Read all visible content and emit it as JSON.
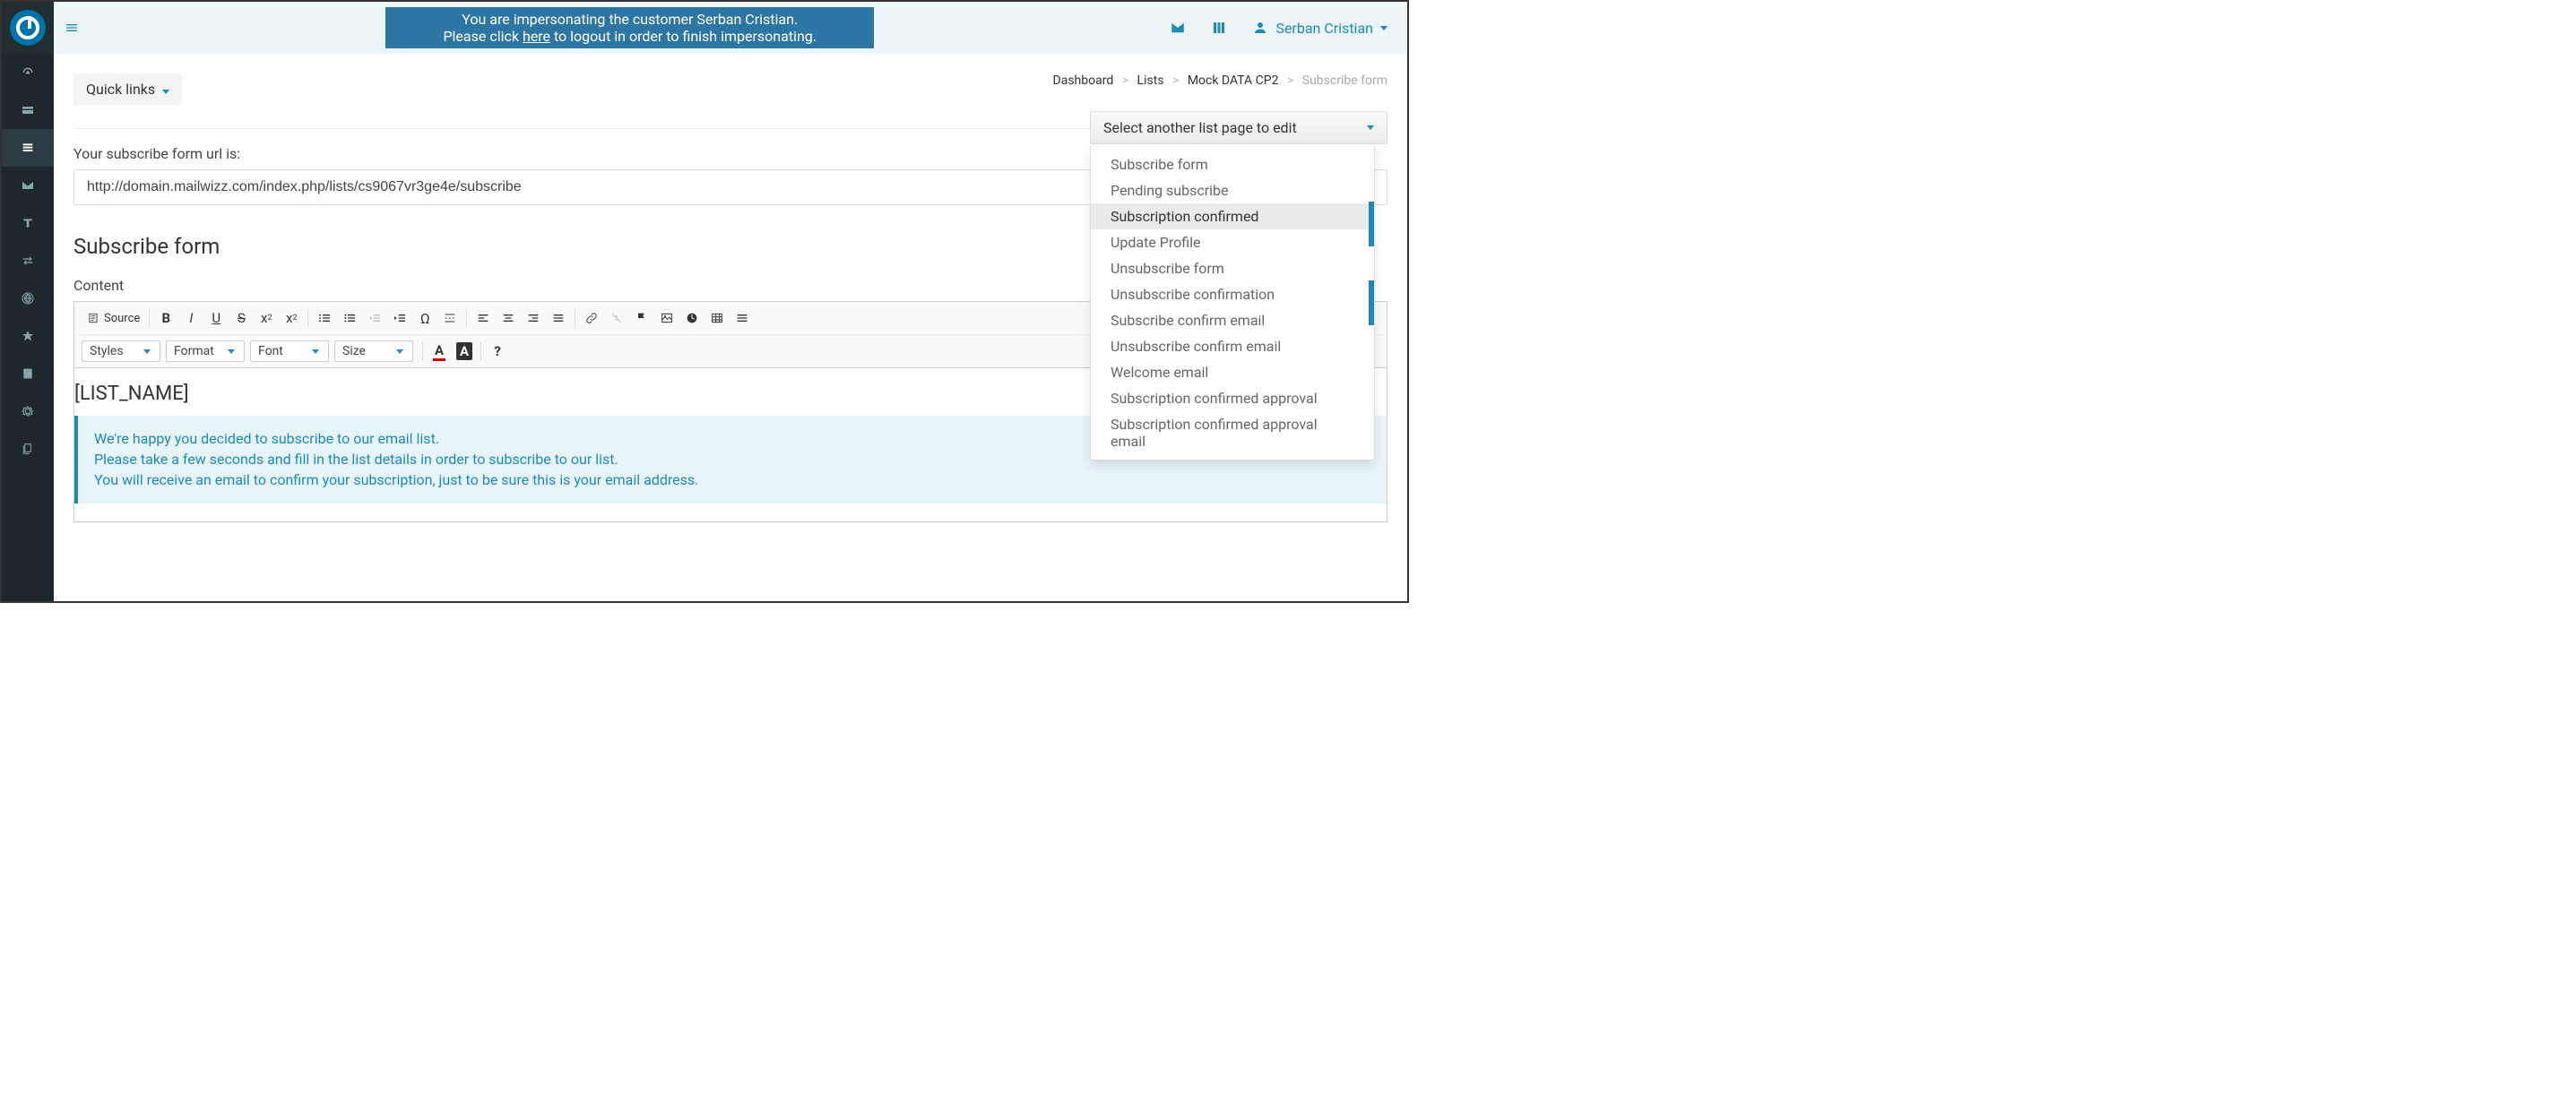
{
  "impersonate": {
    "line1_pre": "You are impersonating the customer ",
    "customer": "Serban Cristian",
    "line1_post": ".",
    "line2_pre": "Please click ",
    "link": "here",
    "line2_post": " to logout in order to finish impersonating."
  },
  "user_name": "Serban Cristian",
  "breadcrumb": {
    "a": "Dashboard",
    "b": "Lists",
    "c": "Mock DATA CP2",
    "d": "Subscribe form"
  },
  "quick_links_label": "Quick links",
  "page_select": {
    "label": "Select another list page to edit",
    "items": [
      "Subscribe form",
      "Pending subscribe",
      "Subscription confirmed",
      "Update Profile",
      "Unsubscribe form",
      "Unsubscribe confirmation",
      "Subscribe confirm email",
      "Unsubscribe confirm email",
      "Welcome email",
      "Subscription confirmed approval",
      "Subscription confirmed approval email"
    ],
    "hover_index": 2
  },
  "url_label": "Your subscribe form url is:",
  "url_value": "http://domain.mailwizz.com/index.php/lists/cs9067vr3ge4e/subscribe",
  "section_title": "Subscribe form",
  "content_label": "Content",
  "toolbar": {
    "source": "Source",
    "styles": "Styles",
    "format": "Format",
    "font": "Font",
    "size": "Size"
  },
  "editor_body": {
    "heading": "[LIST_NAME]",
    "callout_l1": "We're happy you decided to subscribe to our email list.",
    "callout_l2": "Please take a few seconds and fill in the list details in order to subscribe to our list.",
    "callout_l3": "You will receive an email to confirm your subscription, just to be sure this is your email address."
  }
}
